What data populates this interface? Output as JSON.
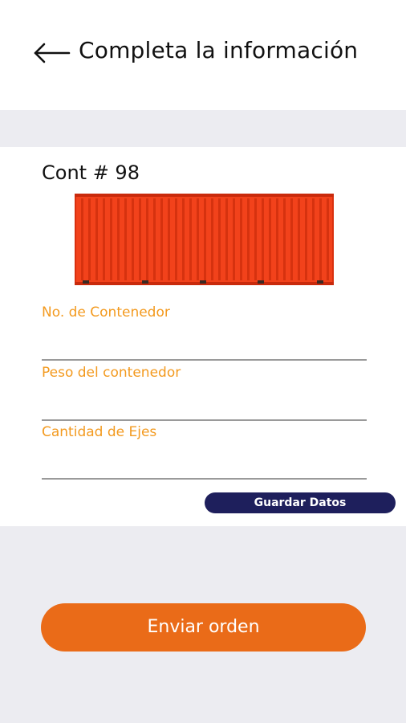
{
  "header": {
    "back_icon": "arrow-left-icon",
    "title": "Completa la información"
  },
  "container": {
    "title": "Cont # 98",
    "image_icon": "shipping-container-image",
    "color": "#f2421b"
  },
  "form": {
    "fields": [
      {
        "label": "No. de Contenedor",
        "value": ""
      },
      {
        "label": "Peso del contenedor",
        "value": ""
      },
      {
        "label": "Cantidad de Ejes",
        "value": ""
      }
    ],
    "label_color": "#f39a1f",
    "save_label": "Guardar Datos",
    "save_color": "#1e1f5c"
  },
  "footer": {
    "send_label": "Enviar orden",
    "send_color": "#ea6b18"
  }
}
